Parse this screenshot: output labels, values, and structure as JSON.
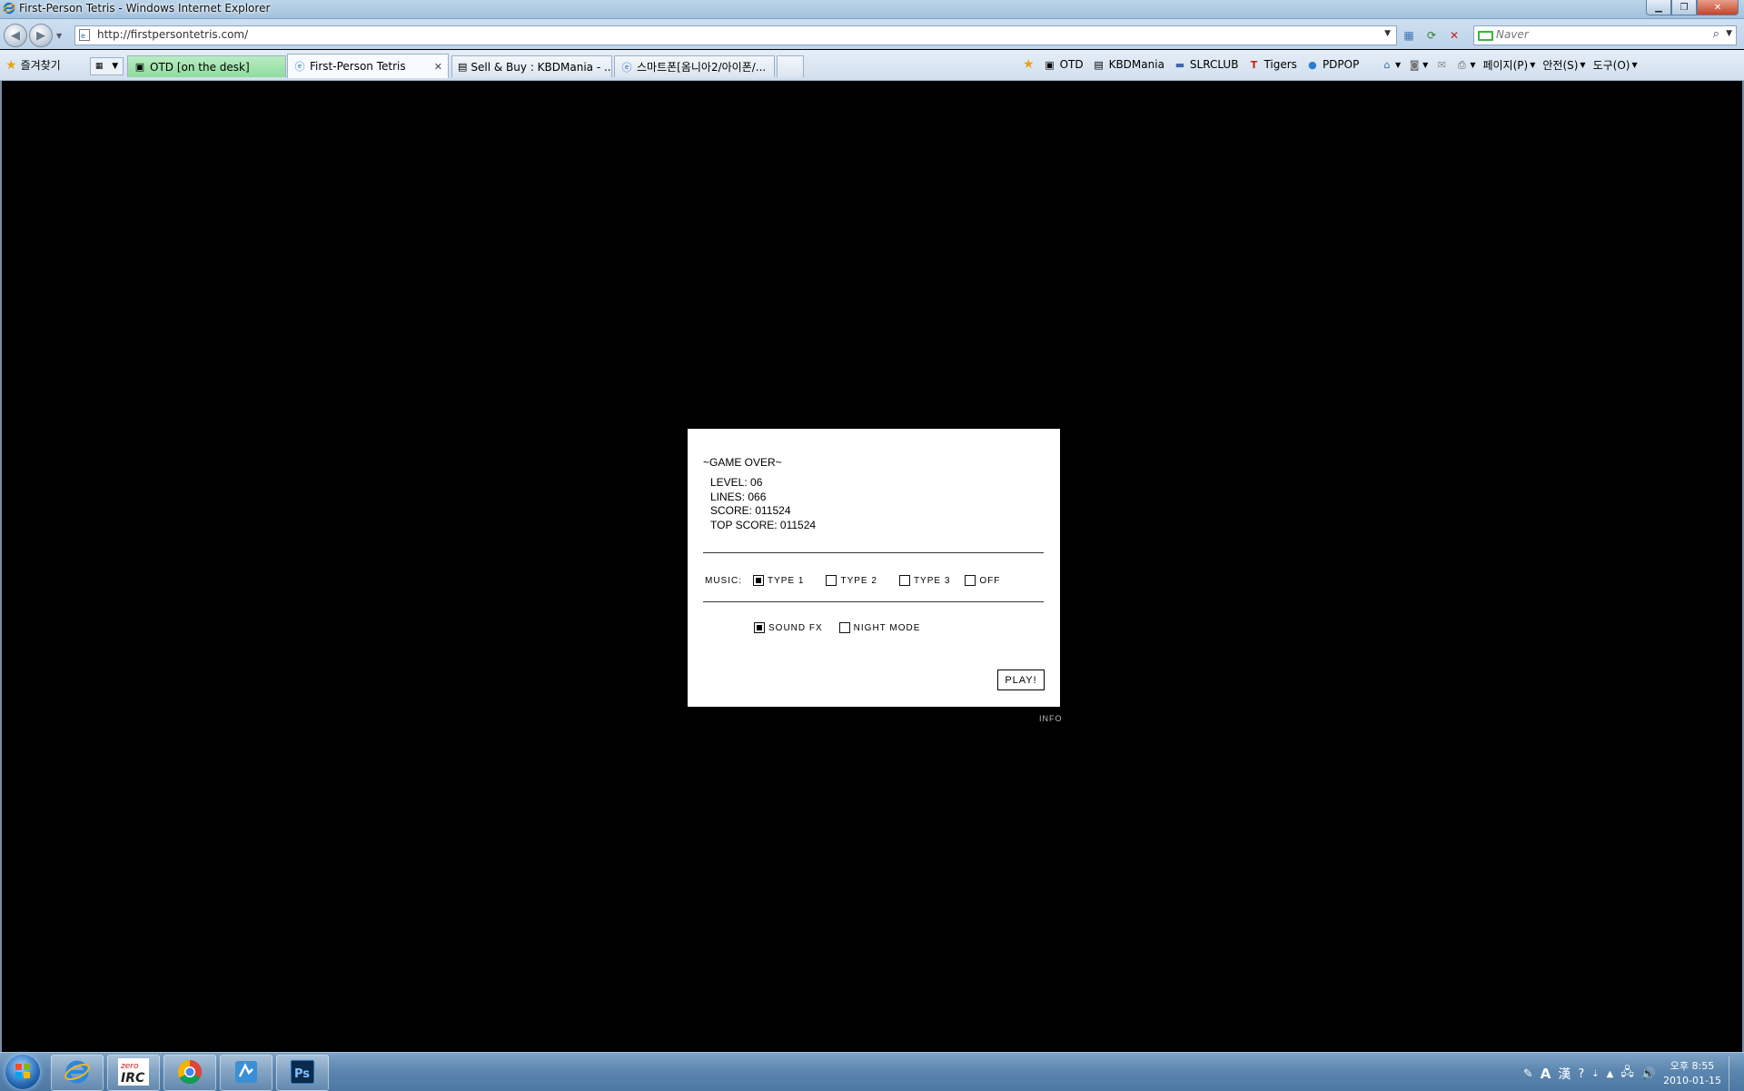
{
  "window": {
    "title": "First-Person Tetris - Windows Internet Explorer"
  },
  "address_bar": {
    "url": "http://firstpersontetris.com/",
    "search_placeholder": "Naver"
  },
  "favorites": {
    "label": "즐겨찾기"
  },
  "tabs": [
    {
      "label": "OTD [on the desk]",
      "active": false
    },
    {
      "label": "First-Person Tetris",
      "active": true
    },
    {
      "label": "Sell & Buy : KBDMania - ...",
      "active": false
    },
    {
      "label": "스마트폰[옴니아2/아이폰/...",
      "active": false
    }
  ],
  "links_bar": [
    {
      "label": "OTD",
      "icon": "otd-icon"
    },
    {
      "label": "KBDMania",
      "icon": "page-icon"
    },
    {
      "label": "SLRCLUB",
      "icon": "slr-icon"
    },
    {
      "label": "Tigers",
      "icon": "tigers-icon"
    },
    {
      "label": "PDPOP",
      "icon": "globe-icon"
    }
  ],
  "command_bar": {
    "page_menu": "페이지(P)",
    "safety_menu": "안전(S)",
    "tools_menu": "도구(O)"
  },
  "game": {
    "status_title": "~GAME OVER~",
    "stats": {
      "level": "LEVEL: 06",
      "lines": "LINES: 066",
      "score": "SCORE: 011524",
      "top_score": "TOP SCORE: 011524"
    },
    "music": {
      "label": "MUSIC:",
      "options": [
        {
          "label": "TYPE 1",
          "checked": true
        },
        {
          "label": "TYPE 2",
          "checked": false
        },
        {
          "label": "TYPE 3",
          "checked": false
        },
        {
          "label": "OFF",
          "checked": false
        }
      ]
    },
    "sound_fx": {
      "label": "SOUND FX",
      "checked": true
    },
    "night_mode": {
      "label": "NIGHT MODE",
      "checked": false
    },
    "play_button": "PLAY!",
    "info_link": "INFO"
  },
  "taskbar": {
    "apps": [
      "internet-explorer",
      "zero-irc",
      "chrome",
      "app-puzzle",
      "photoshop"
    ],
    "ime_labels": [
      "A",
      "漢"
    ],
    "clock_time": "오후 8:55",
    "clock_date": "2010-01-15"
  },
  "colors": {
    "content_bg": "#000000",
    "dialog_bg": "#ffffff",
    "tab_otd_bg": "#8fdc9e",
    "taskbar": "#5d87b0"
  }
}
